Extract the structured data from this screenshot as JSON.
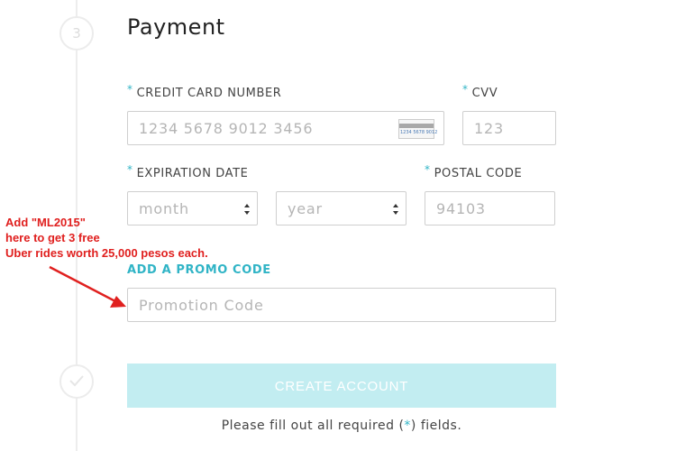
{
  "step": {
    "number": "3"
  },
  "section_title": "Payment",
  "required_marker": "*",
  "fields": {
    "card_number": {
      "label": "CREDIT CARD NUMBER",
      "placeholder": "1234 5678 9012 3456",
      "card_icon_digits": "1234 5678 9012"
    },
    "cvv": {
      "label": "CVV",
      "placeholder": "123"
    },
    "expiration": {
      "label": "EXPIRATION DATE",
      "month_placeholder": "month",
      "year_placeholder": "year"
    },
    "postal_code": {
      "label": "POSTAL CODE",
      "placeholder": "94103"
    },
    "promo": {
      "link_text": "ADD A PROMO CODE",
      "placeholder": "Promotion Code"
    }
  },
  "create_button": "CREATE ACCOUNT",
  "footnote": {
    "before": "Please fill out all required (",
    "marker": "*",
    "after": ") fields."
  },
  "annotation": {
    "lines": [
      "Add \"ML2015\"",
      "here to get 3 free",
      "Uber rides worth 25,000 pesos each."
    ],
    "color": "#e0201f"
  },
  "colors": {
    "accent": "#30b4c6",
    "button_bg": "#c2edf1"
  }
}
